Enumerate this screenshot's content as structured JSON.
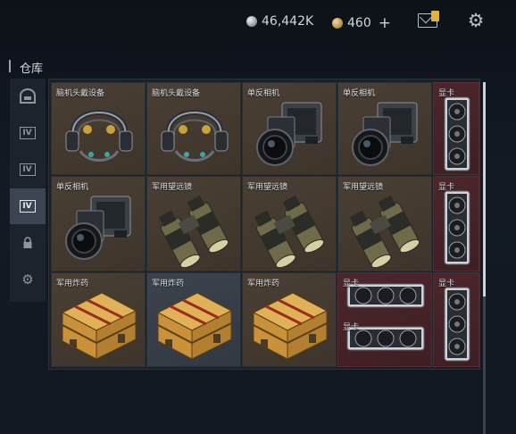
{
  "topbar": {
    "silver_amount": "46,442K",
    "gold_amount": "460",
    "plus_label": "+",
    "mail_icon": "mail-icon",
    "settings_icon": "gear-icon"
  },
  "section": {
    "title": "仓库"
  },
  "sidebar": {
    "tabs": [
      {
        "icon": "helmet-icon",
        "active": false
      },
      {
        "icon": "iv-box-icon",
        "active": false
      },
      {
        "icon": "iv-box-icon",
        "active": false
      },
      {
        "icon": "iv-box-icon",
        "active": true
      },
      {
        "icon": "lock-icon",
        "active": false
      },
      {
        "icon": "gear-icon",
        "active": false
      }
    ]
  },
  "inventory": {
    "items": [
      {
        "label": "脑机头戴设备",
        "type": "headset"
      },
      {
        "label": "脑机头戴设备",
        "type": "headset"
      },
      {
        "label": "单反相机",
        "type": "camera"
      },
      {
        "label": "单反相机",
        "type": "camera"
      },
      {
        "label": "显卡",
        "type": "gpu"
      },
      {
        "label": "单反相机",
        "type": "camera"
      },
      {
        "label": "军用望远镜",
        "type": "binoculars"
      },
      {
        "label": "军用望远镜",
        "type": "binoculars"
      },
      {
        "label": "军用望远镜",
        "type": "binoculars"
      },
      {
        "label": "显卡",
        "type": "gpu"
      },
      {
        "label": "军用炸药",
        "type": "explosives"
      },
      {
        "label": "军用炸药",
        "type": "explosives"
      },
      {
        "label": "军用炸药",
        "type": "explosives"
      },
      {
        "label": "显卡",
        "type": "gpu"
      },
      {
        "label": "显卡",
        "type": "gpu"
      }
    ],
    "colors": {
      "brown": "#4a3f34",
      "grey": "#3c434c",
      "red": "#4c262b"
    }
  }
}
